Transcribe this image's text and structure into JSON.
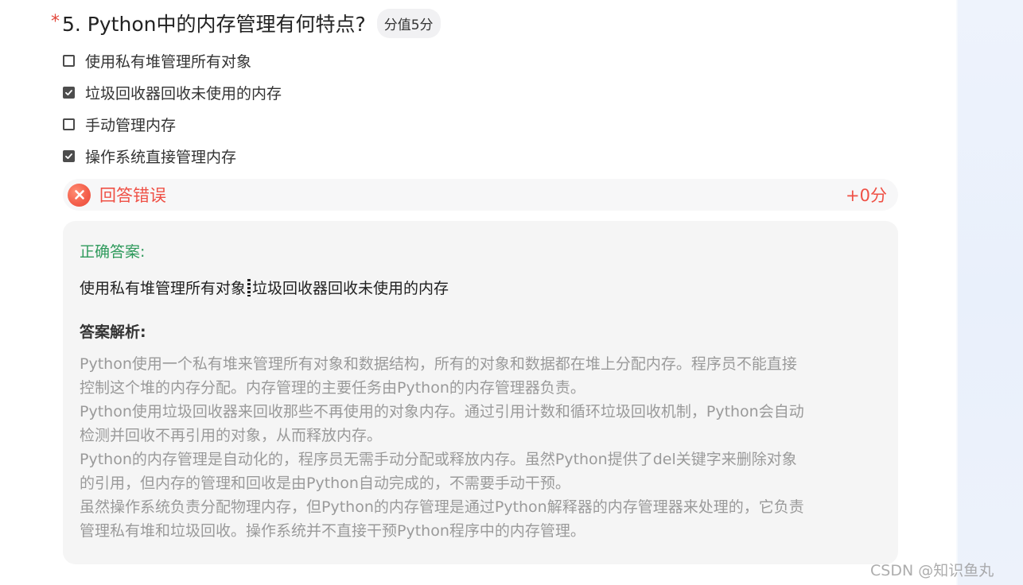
{
  "question": {
    "required_mark": "*",
    "title": "5. Python中的内存管理有何特点?",
    "score_badge": "分值5分"
  },
  "options": [
    {
      "label": "使用私有堆管理所有对象",
      "checked": false
    },
    {
      "label": "垃圾回收器回收未使用的内存",
      "checked": true
    },
    {
      "label": "手动管理内存",
      "checked": false
    },
    {
      "label": "操作系统直接管理内存",
      "checked": true
    }
  ],
  "result": {
    "icon": "wrong-circle-icon",
    "status_text": "回答错误",
    "score_text": "+0分"
  },
  "answer": {
    "correct_label": "正确答案:",
    "correct_items": [
      "使用私有堆管理所有对象",
      "垃圾回收器回收未使用的内存"
    ],
    "analysis_label": "答案解析:",
    "analysis_lines": [
      "Python使用一个私有堆来管理所有对象和数据结构，所有的对象和数据都在堆上分配内存。程序员不能直接",
      "控制这个堆的内存分配。内存管理的主要任务由Python的内存管理器负责。",
      "Python使用垃圾回收器来回收那些不再使用的对象内存。通过引用计数和循环垃圾回收机制，Python会自动",
      "检测并回收不再引用的对象，从而释放内存。",
      "Python的内存管理是自动化的，程序员无需手动分配或释放内存。虽然Python提供了del关键字来删除对象",
      "的引用，但内存的管理和回收是由Python自动完成的，不需要手动干预。",
      "虽然操作系统负责分配物理内存，但Python的内存管理是通过Python解释器的内存管理器来处理的，它负责",
      "管理私有堆和垃圾回收。操作系统并不直接干预Python程序中的内存管理。"
    ]
  },
  "watermark": "CSDN @知识鱼丸",
  "colors": {
    "accent_error": "#ef5045",
    "accent_correct": "#2f9a5c",
    "required": "#e2463a"
  }
}
